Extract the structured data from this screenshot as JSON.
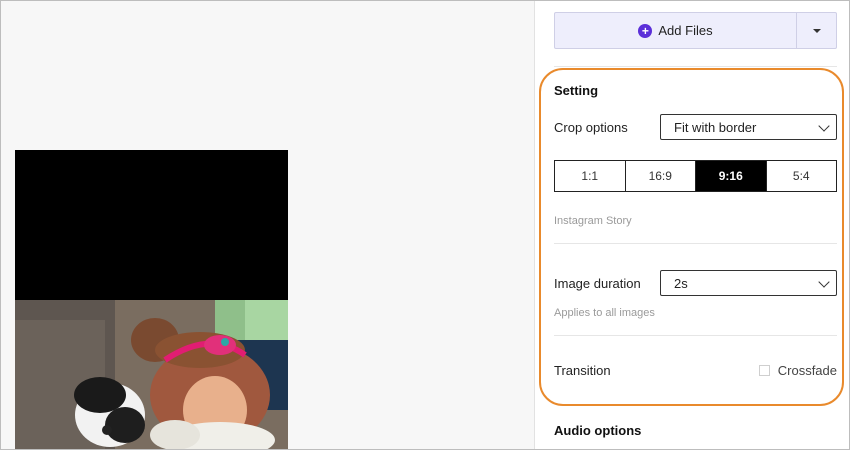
{
  "toolbar": {
    "add_files_label": "Add Files",
    "add_files_icon": "plus-circle-icon",
    "dropdown_icon": "caret-down-icon",
    "accent_color": "#5b2fd9"
  },
  "setting": {
    "title": "Setting",
    "crop_options": {
      "label": "Crop options",
      "value": "Fit with border"
    },
    "aspect_ratios": [
      {
        "label": "1:1",
        "selected": false
      },
      {
        "label": "16:9",
        "selected": false
      },
      {
        "label": "9:16",
        "selected": true
      },
      {
        "label": "5:4",
        "selected": false
      }
    ],
    "aspect_hint": "Instagram Story",
    "image_duration": {
      "label": "Image duration",
      "value": "2s",
      "hint": "Applies to all images"
    },
    "transition": {
      "label": "Transition",
      "crossfade_label": "Crossfade",
      "crossfade_checked": false
    },
    "highlight_color": "#e98a2c"
  },
  "audio": {
    "title": "Audio options"
  }
}
